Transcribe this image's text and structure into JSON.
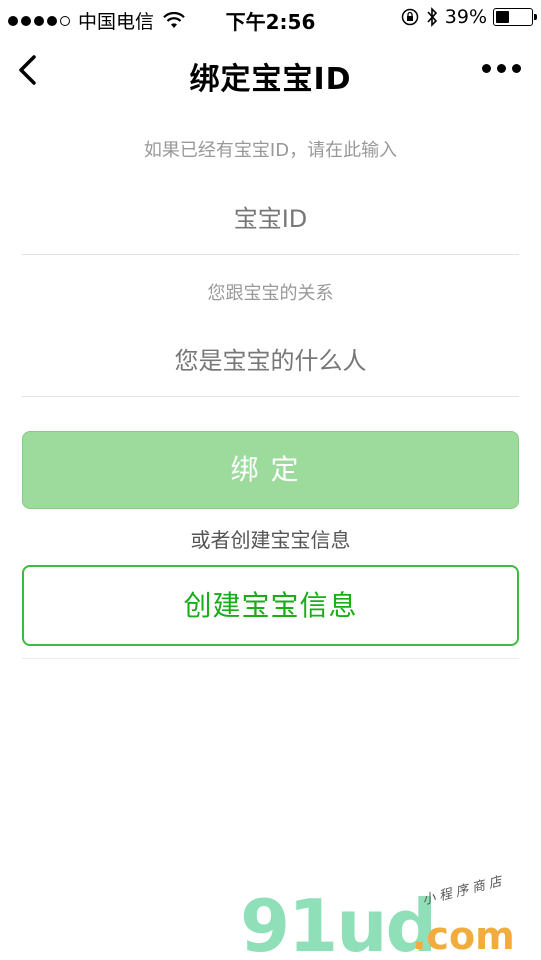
{
  "status_bar": {
    "carrier": "中国电信",
    "time": "下午2:56",
    "battery_percent": "39%",
    "battery_level": 0.39,
    "signal_bars_filled": 4,
    "signal_bars_total": 5
  },
  "nav": {
    "title": "绑定宝宝ID",
    "back_icon": "chevron-left-icon",
    "more_icon": "more-horizontal-icon"
  },
  "form": {
    "hint_id": "如果已经有宝宝ID，请在此输入",
    "id_placeholder": "宝宝ID",
    "hint_relation": "您跟宝宝的关系",
    "relation_placeholder": "您是宝宝的什么人"
  },
  "actions": {
    "bind_label": "绑定",
    "or_text": "或者创建宝宝信息",
    "create_label": "创建宝宝信息"
  },
  "colors": {
    "primary_green": "#1aad19",
    "disabled_green": "#9ddb9c"
  },
  "watermark": {
    "main": "91ud",
    "domain": ".com",
    "tagline": "小程序商店"
  }
}
